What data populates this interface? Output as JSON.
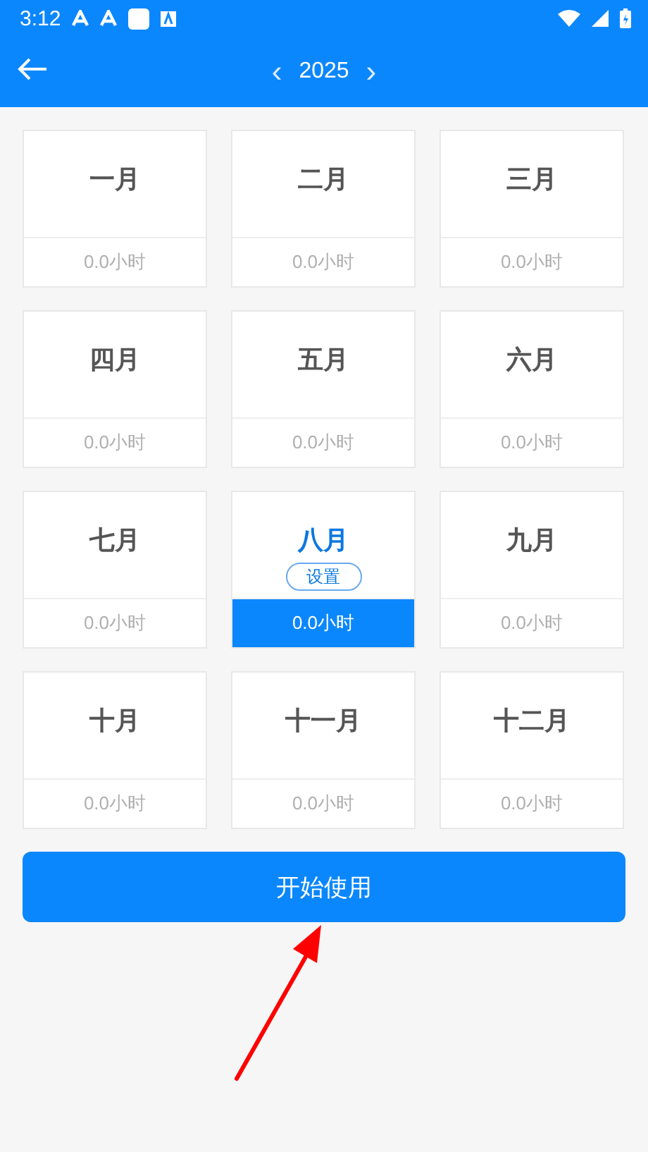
{
  "status_bar": {
    "time": "3:12"
  },
  "header": {
    "year": "2025",
    "prev": "‹",
    "next": "›"
  },
  "months": [
    {
      "label": "一月",
      "hours": "0.0小时",
      "selected": false
    },
    {
      "label": "二月",
      "hours": "0.0小时",
      "selected": false
    },
    {
      "label": "三月",
      "hours": "0.0小时",
      "selected": false
    },
    {
      "label": "四月",
      "hours": "0.0小时",
      "selected": false
    },
    {
      "label": "五月",
      "hours": "0.0小时",
      "selected": false
    },
    {
      "label": "六月",
      "hours": "0.0小时",
      "selected": false
    },
    {
      "label": "七月",
      "hours": "0.0小时",
      "selected": false
    },
    {
      "label": "八月",
      "hours": "0.0小时",
      "selected": true,
      "action": "设置"
    },
    {
      "label": "九月",
      "hours": "0.0小时",
      "selected": false
    },
    {
      "label": "十月",
      "hours": "0.0小时",
      "selected": false
    },
    {
      "label": "十一月",
      "hours": "0.0小时",
      "selected": false
    },
    {
      "label": "十二月",
      "hours": "0.0小时",
      "selected": false
    }
  ],
  "start_button": "开始使用"
}
